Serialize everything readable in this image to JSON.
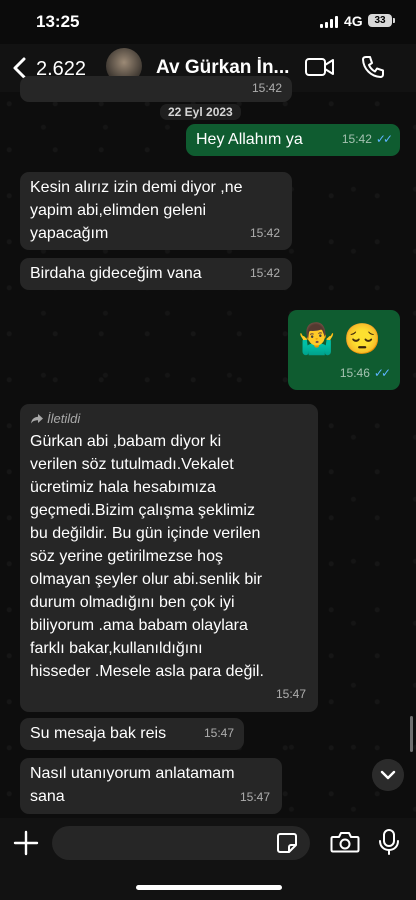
{
  "status_bar": {
    "time": "13:25",
    "network": "4G",
    "battery": "33"
  },
  "header": {
    "back_count": "2.622",
    "contact_name": "Av Gürkan İn..."
  },
  "date_separator": "22 Eyl 2023",
  "messages": [
    {
      "direction": "out",
      "text": "Hey Allahım ya",
      "time": "15:42",
      "status": "read"
    },
    {
      "direction": "in",
      "lines": [
        "Kesin alırız izin demi diyor ,ne",
        "yapim abi,elimden geleni",
        "yapacağım"
      ],
      "time": "15:42"
    },
    {
      "direction": "in",
      "text": "Birdaha gideceğim vana",
      "time": "15:42"
    },
    {
      "direction": "out",
      "emoji": "🤷‍♂️ 😔",
      "time": "15:46",
      "status": "read"
    },
    {
      "direction": "in",
      "forwarded_label": "İletildi",
      "lines": [
        "Gürkan abi ,babam diyor ki",
        "verilen söz tutulmadı.Vekalet",
        "ücretimiz hala hesabımıza",
        "geçmedi.Bizim çalışma şeklimiz",
        "bu değildir. Bu gün içinde verilen",
        "söz yerine getirilmezse hoş",
        "olmayan şeyler olur abi.senlik bir",
        "durum olmadığını ben çok iyi",
        "biliyorum .ama babam olaylara",
        "farklı bakar,kullanıldığını",
        "hisseder .Mesele asla para değil."
      ],
      "time": "15:47"
    },
    {
      "direction": "in",
      "text": "Su mesaja bak reis",
      "time": "15:47"
    },
    {
      "direction": "in",
      "lines": [
        "Nasıl utanıyorum anlatamam",
        "sana"
      ],
      "time": "15:47"
    }
  ],
  "top_partial_time": "15:42",
  "composer": {
    "placeholder": ""
  },
  "icons": [
    "back-chevron-icon",
    "video-call-icon",
    "phone-icon",
    "forward-icon",
    "read-ticks-icon",
    "chevron-down-icon",
    "plus-icon",
    "sticker-icon",
    "camera-icon",
    "microphone-icon"
  ],
  "colors": {
    "outgoing_bubble": "#0f5c30",
    "incoming_bubble": "#262626",
    "read_ticks": "#5db4ff",
    "background": "#0d0d0d"
  }
}
